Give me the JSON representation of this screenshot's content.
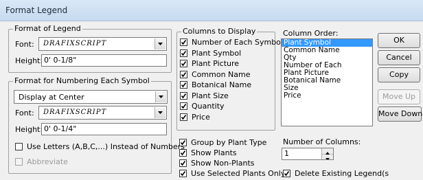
{
  "window": {
    "title": "Format Legend"
  },
  "format_of_legend": {
    "title": "Format of Legend",
    "font_label": "Font:",
    "font_value": "DRAFIXSCRIPT",
    "height_label": "Height:",
    "height_value": "0' 0-1/8\""
  },
  "format_numbering": {
    "title": "Format for Numbering Each Symbol",
    "display_value": "Display at Center",
    "font_label": "Font:",
    "font_value": "DRAFIXSCRIPT",
    "height_label": "Height:",
    "height_value": "0' 0-1/4\"",
    "use_letters_label": "Use Letters (A,B,C,...) Instead of Numbers",
    "abbreviate_label": "Abbreviate"
  },
  "columns_to_display": {
    "title": "Columns to Display",
    "items": [
      {
        "label": "Number of Each Symbol",
        "checked": true
      },
      {
        "label": "Plant Symbol",
        "checked": true
      },
      {
        "label": "Plant Picture",
        "checked": true
      },
      {
        "label": "Common Name",
        "checked": true
      },
      {
        "label": "Botanical Name",
        "checked": true
      },
      {
        "label": "Plant Size",
        "checked": true
      },
      {
        "label": "Quantity",
        "checked": true
      },
      {
        "label": "Price",
        "checked": true
      }
    ]
  },
  "column_order": {
    "label": "Column Order:",
    "items": [
      "Plant Symbol",
      "Common Name",
      "Qty",
      "Number of Each",
      "Plant Picture",
      "Botanical Name",
      "Size",
      "Price"
    ],
    "selected_index": 0
  },
  "buttons": {
    "ok": "OK",
    "cancel": "Cancel",
    "copy": "Copy",
    "move_up": "Move Up",
    "move_down": "Move Down"
  },
  "options": {
    "group_by_plant_type": "Group by Plant Type",
    "show_plants": "Show Plants",
    "show_non_plants": "Show Non-Plants",
    "use_selected_plants_only": "Use Selected Plants Only",
    "delete_existing_legends": "Delete Existing Legend(s"
  },
  "number_of_columns": {
    "label": "Number of Columns:",
    "value": "1"
  }
}
